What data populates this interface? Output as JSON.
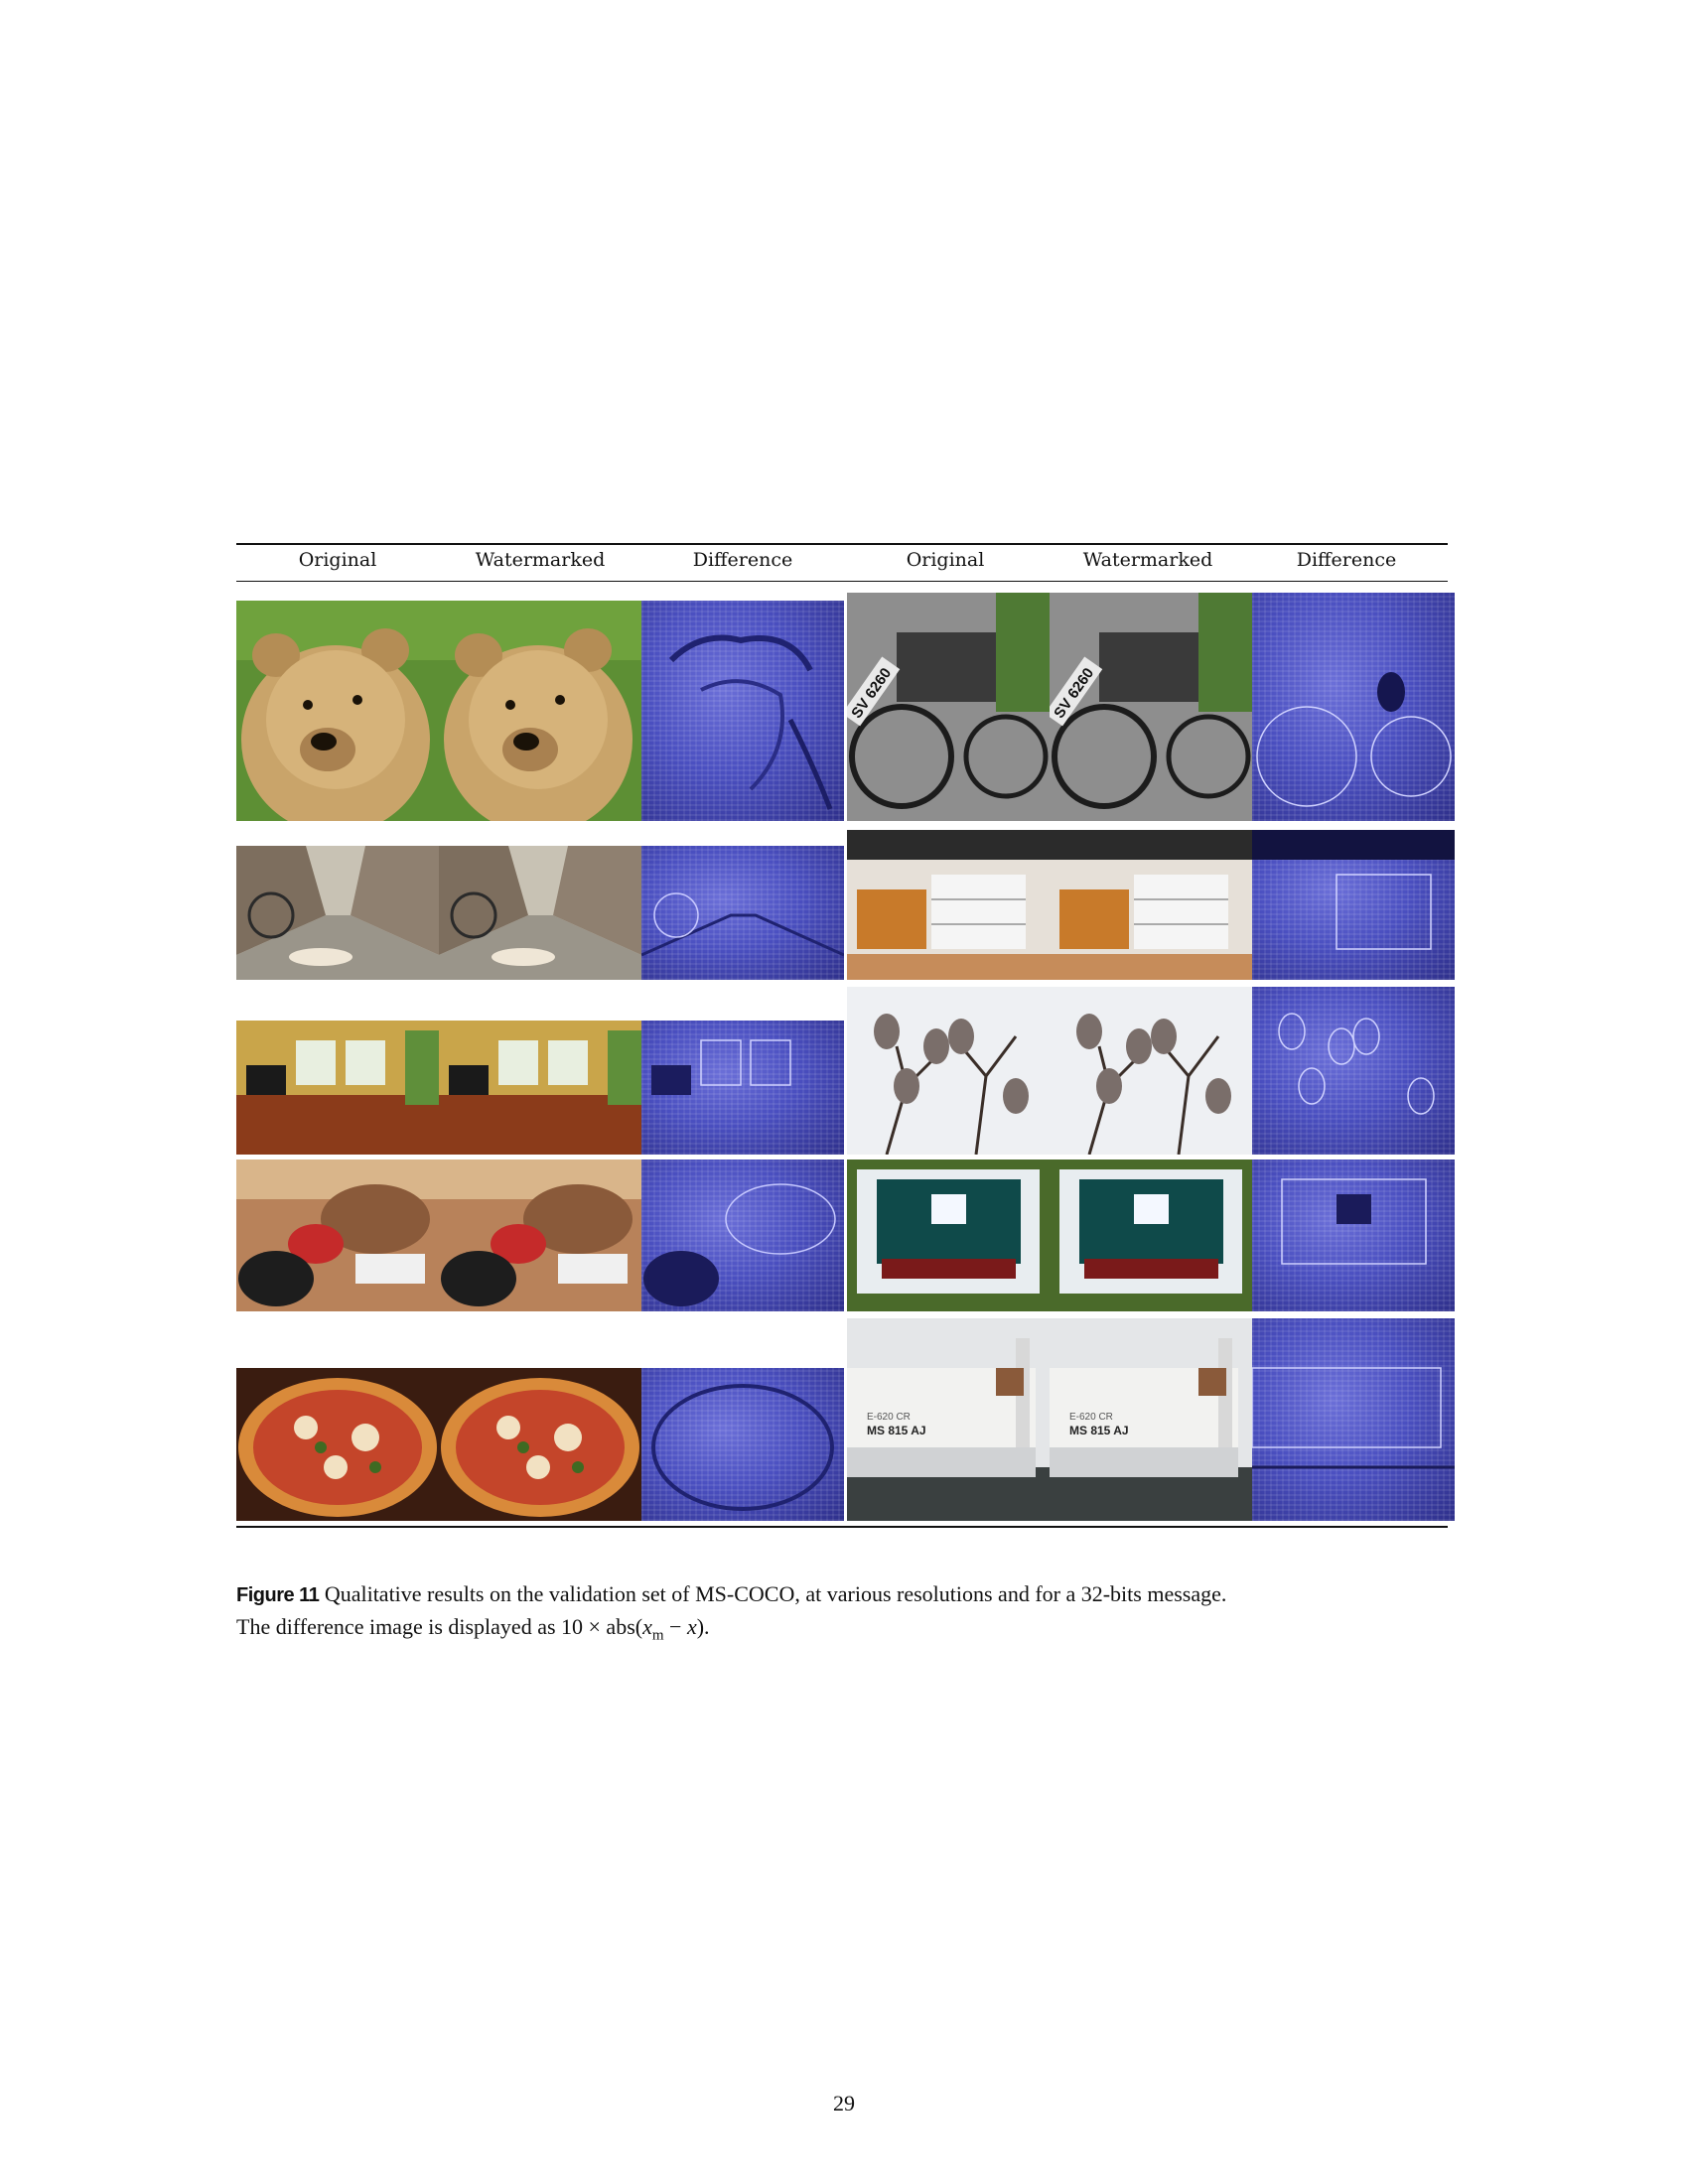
{
  "figure": {
    "columns": [
      "Original",
      "Watermarked",
      "Difference",
      "Original",
      "Watermarked",
      "Difference"
    ],
    "images": {
      "left_rows": [
        "bear",
        "street-dog",
        "living-room",
        "puppy-shoes",
        "pizza"
      ],
      "right_rows": [
        "motorcycle",
        "desk",
        "birds",
        "projector",
        "boat"
      ]
    },
    "plate_text": {
      "motorcycle": "SV 6260",
      "boat_line1": "E-620 CR",
      "boat_line2": "MS 815 AJ"
    }
  },
  "caption": {
    "label": "Figure 11",
    "text_1": " Qualitative results on the validation set of MS-COCO, at various resolutions and for a 32-bits message.",
    "text_2": "The difference image is displayed as 10 × abs(",
    "formula_x": "x",
    "formula_sub": "m",
    "text_3": " − ",
    "formula_x2": "x",
    "text_4": ")."
  },
  "page_number": "29"
}
